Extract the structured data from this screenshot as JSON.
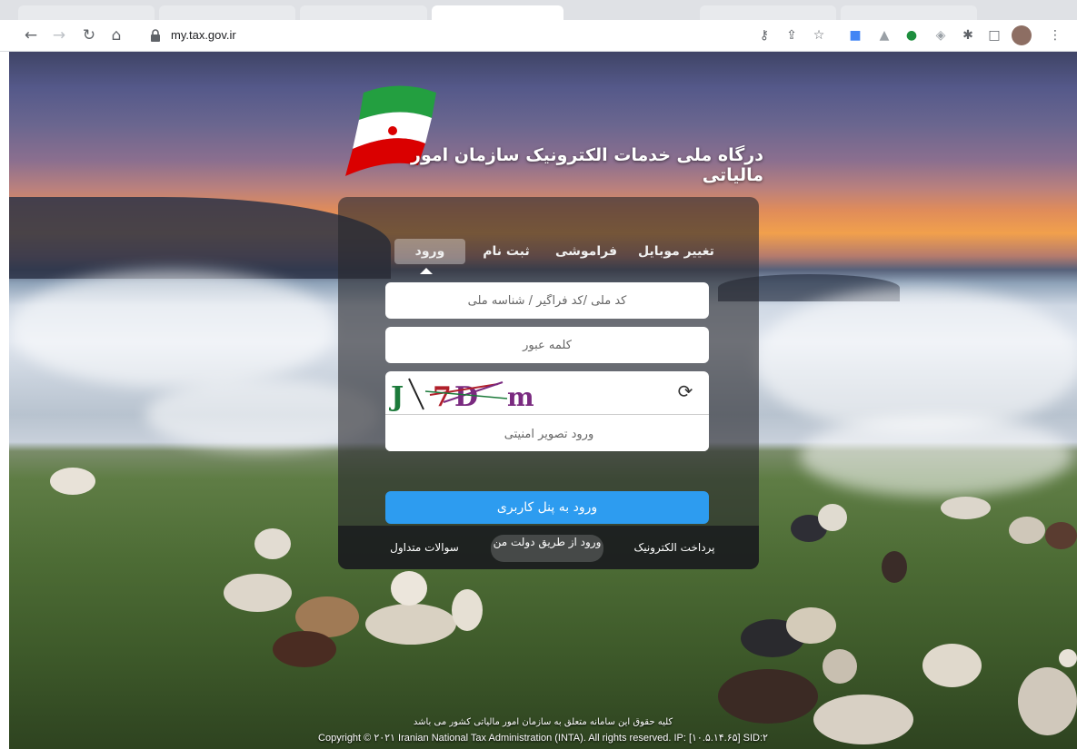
{
  "browser": {
    "url": "my.tax.gov.ir"
  },
  "portal": {
    "title": "درگاه ملی خدمات الکترونیک سازمان امور مالیاتی"
  },
  "login": {
    "tabs": [
      {
        "label": "تغییر موبایل"
      },
      {
        "label": "فراموشی"
      },
      {
        "label": "ثبت نام"
      },
      {
        "label": "ورود",
        "active": true
      }
    ],
    "national_code_placeholder": "کد ملی /کد فراگیر / شناسه ملی",
    "password_placeholder": "کلمه عبور",
    "captcha_text": "J 7D m",
    "captcha_placeholder": "ورود تصویر امنیتی",
    "submit_label": "ورود به پنل کاربری",
    "links": {
      "payment": "پرداخت الکترونیک",
      "dolat_man": "ورود از طریق دولت من",
      "faq": "سوالات متداول"
    }
  },
  "footer": {
    "rights": "کلیه حقوق این سامانه متعلق به سازمان امور مالیاتی کشور می باشد",
    "copyright": "Copyright © ۲۰۲۱ Iranian National Tax Administration (INTA). All rights reserved. IP: [۱۰.۵.۱۴.۶۵] SID:۲"
  },
  "colors": {
    "accent": "#2d9cf0"
  }
}
